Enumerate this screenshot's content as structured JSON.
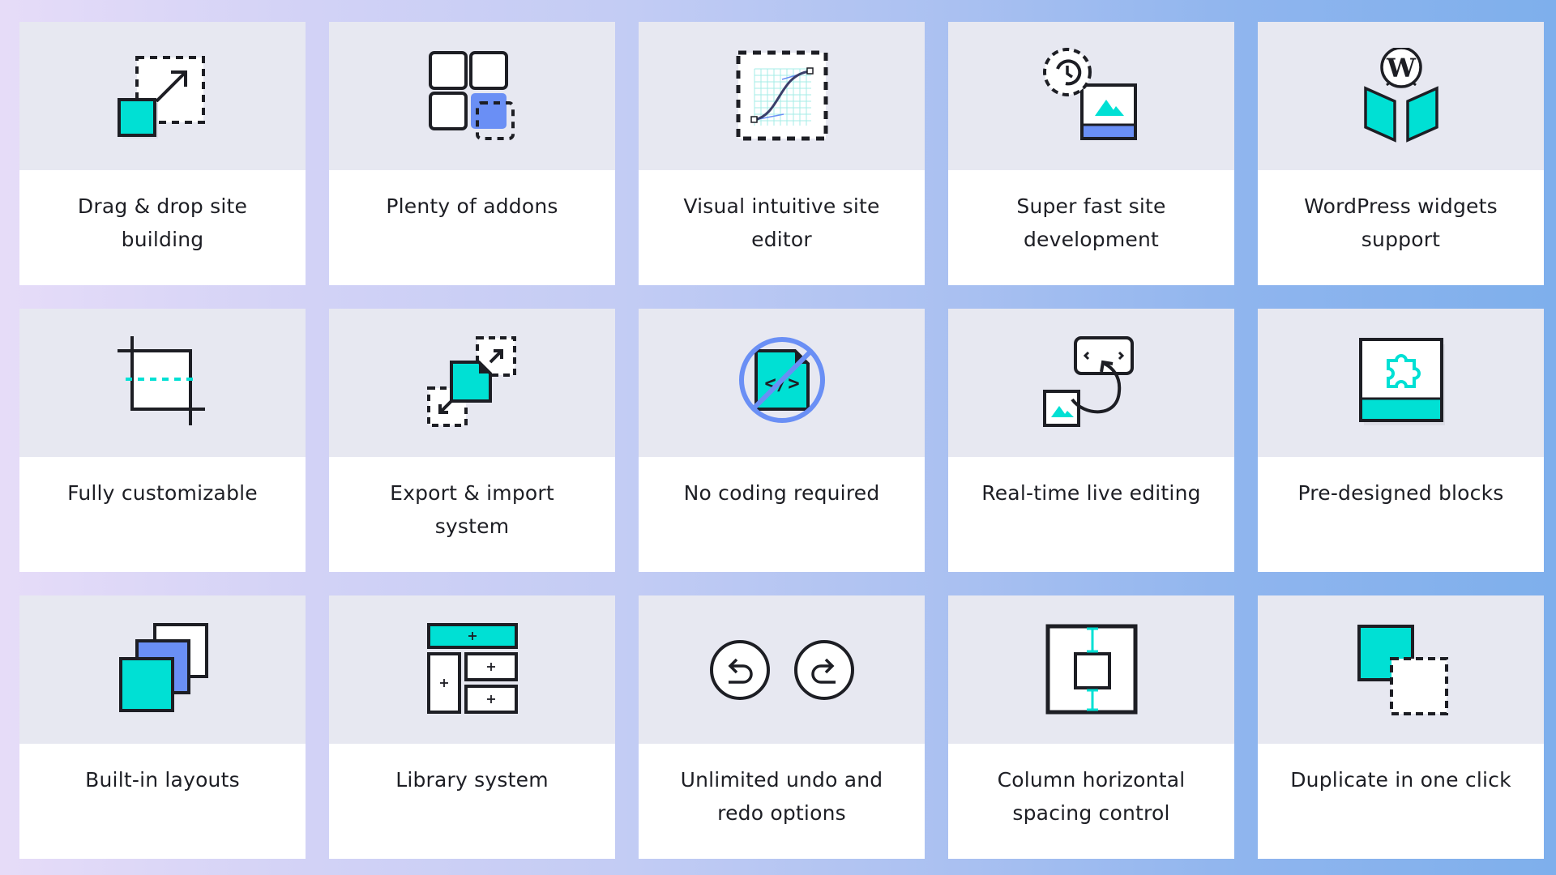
{
  "colors": {
    "teal": "#00e0d4",
    "blue": "#6a8ff5",
    "ink": "#1d1e24",
    "card_top": "#e7e8f1",
    "card_bottom": "#ffffff"
  },
  "features": [
    {
      "title": "Drag & drop site building",
      "icon": "drag-drop-icon"
    },
    {
      "title": "Plenty of addons",
      "icon": "addons-grid-icon"
    },
    {
      "title": "Visual intuitive site editor",
      "icon": "bezier-curve-icon"
    },
    {
      "title": "Super fast site development",
      "icon": "clock-image-icon"
    },
    {
      "title": "WordPress widgets support",
      "icon": "wordpress-book-icon"
    },
    {
      "title": "Fully customizable",
      "icon": "crop-icon"
    },
    {
      "title": "Export & import system",
      "icon": "export-import-icon"
    },
    {
      "title": "No coding required",
      "icon": "no-code-icon"
    },
    {
      "title": "Real-time live editing",
      "icon": "live-editing-icon"
    },
    {
      "title": "Pre-designed blocks",
      "icon": "puzzle-block-icon"
    },
    {
      "title": "Built-in layouts",
      "icon": "stacked-layers-icon"
    },
    {
      "title": "Library system",
      "icon": "library-layout-icon"
    },
    {
      "title": "Unlimited undo and redo options",
      "icon": "undo-redo-icon"
    },
    {
      "title": "Column horizontal spacing control",
      "icon": "spacing-control-icon"
    },
    {
      "title": "Duplicate in one click",
      "icon": "duplicate-icon"
    }
  ]
}
